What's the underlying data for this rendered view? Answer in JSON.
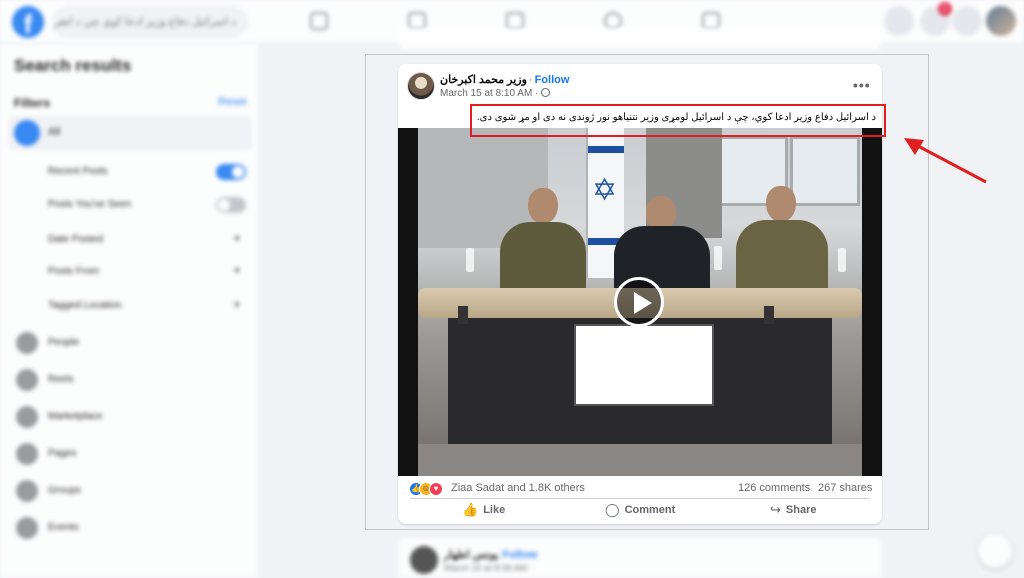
{
  "topbar": {
    "search_text": "د اسرائیل دفاع وزیر ادعا کوي چې د اسر",
    "notification_count": "1"
  },
  "sidebar": {
    "title": "Search results",
    "filters_label": "Filters",
    "reset_label": "Reset",
    "all_label": "All",
    "sub_filters": [
      {
        "label": "Recent Posts",
        "type": "toggle",
        "on": true
      },
      {
        "label": "Posts You've Seen",
        "type": "toggle",
        "on": false
      },
      {
        "label": "Date Posted",
        "type": "dropdown"
      },
      {
        "label": "Posts From",
        "type": "dropdown"
      },
      {
        "label": "Tagged Location",
        "type": "dropdown"
      }
    ],
    "items": [
      {
        "label": "People"
      },
      {
        "label": "Reels"
      },
      {
        "label": "Marketplace"
      },
      {
        "label": "Pages"
      },
      {
        "label": "Groups"
      },
      {
        "label": "Events"
      }
    ]
  },
  "post": {
    "author": "وزیر محمد اکبرخان",
    "separator": "·",
    "follow_label": "Follow",
    "timestamp": "March 15 at 8:10 AM ·",
    "caption": "د اسرائیل دفاع وزیر ادعا کوي، چې د اسرائیل لومړی وزیر نتنیاهو نور ژوندی نه دی او مړ شوی دی.",
    "reaction_names": "Ziaa Sadat and 1.8K others",
    "comments": "126 comments",
    "shares": "267 shares",
    "actions": {
      "like": "Like",
      "comment": "Comment",
      "share": "Share"
    }
  },
  "next_post": {
    "author": "یونس اطهار",
    "follow_label": "Follow",
    "timestamp": "March 15 at 8:08 AM ·"
  },
  "colors": {
    "brand": "#1877f2",
    "annotation_red": "#e02020",
    "notification_red": "#e41e3f"
  },
  "icons": [
    "facebook-logo",
    "search-icon",
    "home-icon",
    "video-icon",
    "marketplace-icon",
    "groups-icon",
    "gaming-icon",
    "menu-icon",
    "messenger-icon",
    "bell-icon",
    "globe-icon",
    "more-icon",
    "play-icon",
    "like-icon",
    "comment-icon",
    "share-icon",
    "edit-icon"
  ]
}
